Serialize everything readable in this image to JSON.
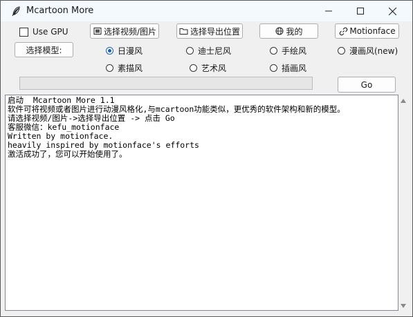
{
  "window": {
    "title": "Mcartoon More"
  },
  "toolbar": {
    "use_gpu_label": "Use GPU",
    "select_media_label": "选择视频/图片",
    "select_export_label": "选择导出位置",
    "mine_label": "我的",
    "motionface_label": "Motionface",
    "select_model_label": "选择模型:"
  },
  "styles": {
    "options": [
      {
        "label": "日漫风",
        "selected": true
      },
      {
        "label": "迪士尼风",
        "selected": false
      },
      {
        "label": "手绘风",
        "selected": false
      },
      {
        "label": "漫画风(new)",
        "selected": false
      },
      {
        "label": "素描风",
        "selected": false
      },
      {
        "label": "艺术风",
        "selected": false
      },
      {
        "label": "插画风",
        "selected": false
      }
    ]
  },
  "progress": {
    "value": 0
  },
  "go_label": "Go",
  "console": {
    "lines": [
      "启动  Mcartoon More 1.1",
      "软件可将视频或者图片进行动漫风格化,与mcartoon功能类似，更优秀的软件架构和新的模型。",
      "请选择视频/图片->选择导出位置 -> 点击 Go",
      "客服微信：kefu_motionface",
      "Written by motionface.",
      "heavily inspired by motionface's efforts",
      "激活成功了，您可以开始使用了。"
    ]
  },
  "colors": {
    "accent": "#1a5fb4",
    "window_bg": "#f0f0f0",
    "titlebar_bg": "#f3f9fc"
  }
}
